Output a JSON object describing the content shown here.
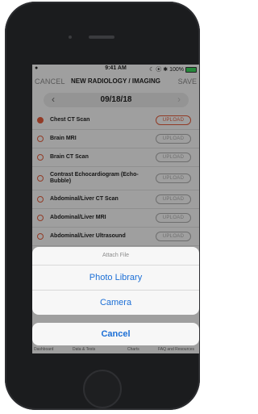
{
  "status": {
    "carrier": "●",
    "time": "9:41 AM",
    "indicators": "☾ ⦿ ✱",
    "battery_text": "100%",
    "battery_level": 1.0
  },
  "nav": {
    "cancel": "CANCEL",
    "title": "NEW RADIOLOGY / IMAGING",
    "save": "SAVE"
  },
  "date": {
    "prev": "‹",
    "value": "09/18/18",
    "next": "›"
  },
  "upload_label": "UPLOAD",
  "items": [
    {
      "label": "Chest CT Scan",
      "checked": true
    },
    {
      "label": "Brain MRI",
      "checked": false
    },
    {
      "label": "Brain CT Scan",
      "checked": false
    },
    {
      "label": "Contrast Echocardiogram (Echo-Bubble)",
      "checked": false
    },
    {
      "label": "Abdominal/Liver CT Scan",
      "checked": false
    },
    {
      "label": "Abdominal/Liver MRI",
      "checked": false
    },
    {
      "label": "Abdominal/Liver Ultrasound",
      "checked": false
    }
  ],
  "tabs": [
    "Dashboard",
    "Data & Tests",
    "Charts",
    "FAQ and Resources"
  ],
  "action_sheet": {
    "title": "Attach File",
    "options": [
      "Photo Library",
      "Camera"
    ],
    "cancel": "Cancel"
  },
  "colors": {
    "accent": "#1c6fd6",
    "radio": "#e05a3a",
    "battery": "#3bd15b"
  }
}
